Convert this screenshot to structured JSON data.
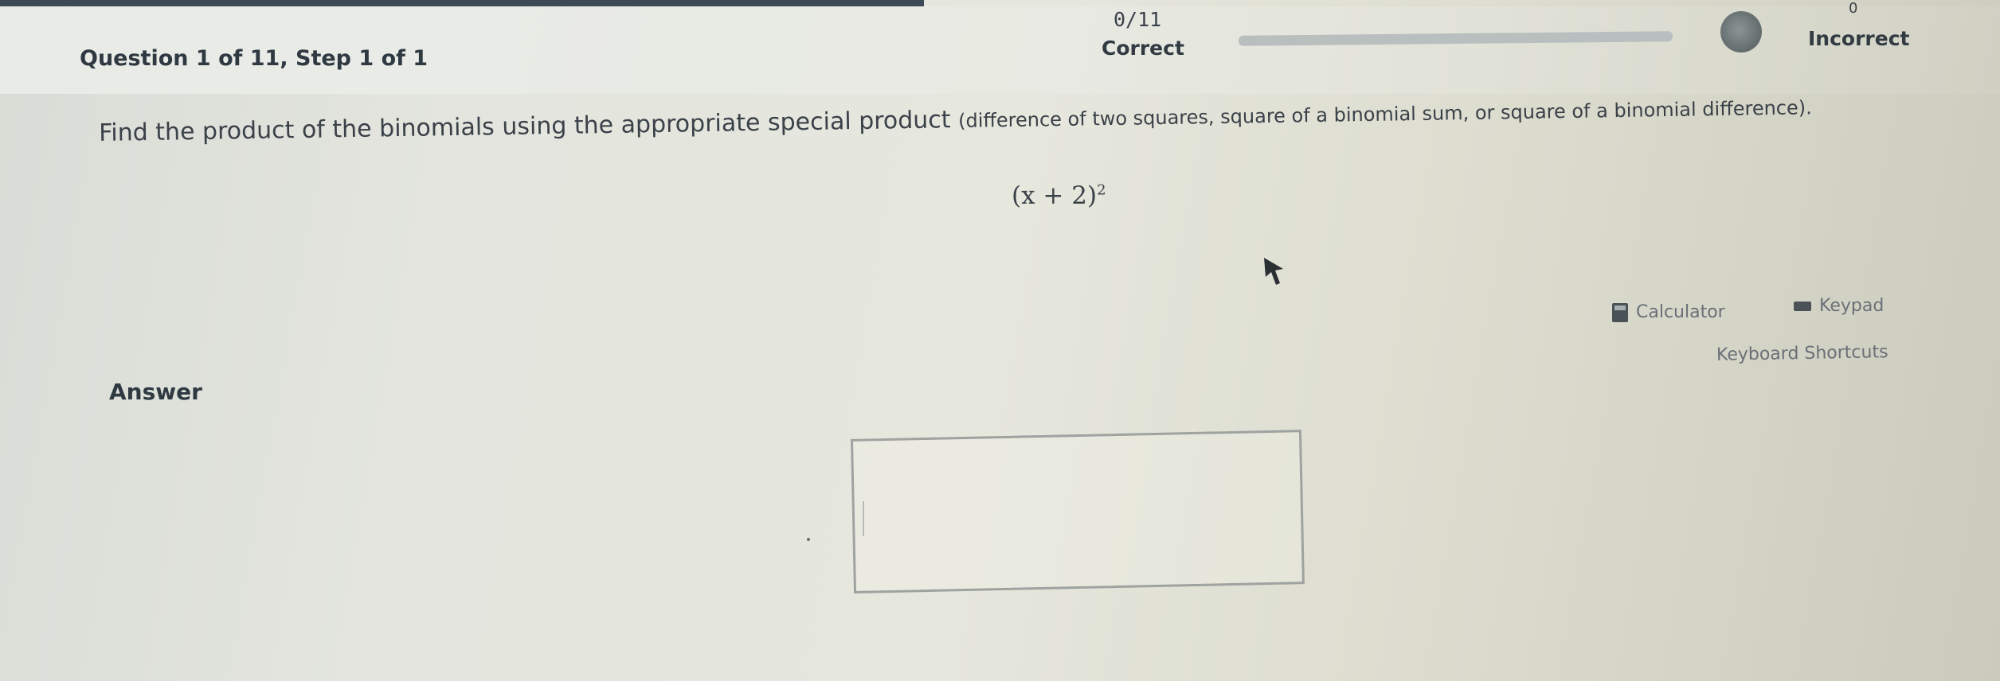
{
  "header": {
    "question_title": "Question 1 of 11,  Step 1 of 1",
    "score": "0/11",
    "correct_label": "Correct",
    "progress_fraction": 0.0,
    "incorrect_count": "0",
    "incorrect_label": "Incorrect",
    "colors": {
      "progress_track": "#b9bfbf",
      "progress_fill": "#7dba6a",
      "incorrect_dot": "#626b6c"
    }
  },
  "question": {
    "instructions_main": "Find the product of the binomials using the appropriate special product ",
    "instructions_paren": "(difference of two squares, square of a binomial sum, or square of a binomial difference).",
    "expression_base": "(x + 2)",
    "expression_exponent": "2"
  },
  "tools": {
    "calculator_label": "Calculator",
    "keypad_label": "Keypad",
    "shortcuts_label": "Keyboard Shortcuts",
    "calculator_icon": "calculator-icon",
    "keypad_icon": "keypad-icon"
  },
  "answer": {
    "label": "Answer",
    "value": ""
  }
}
